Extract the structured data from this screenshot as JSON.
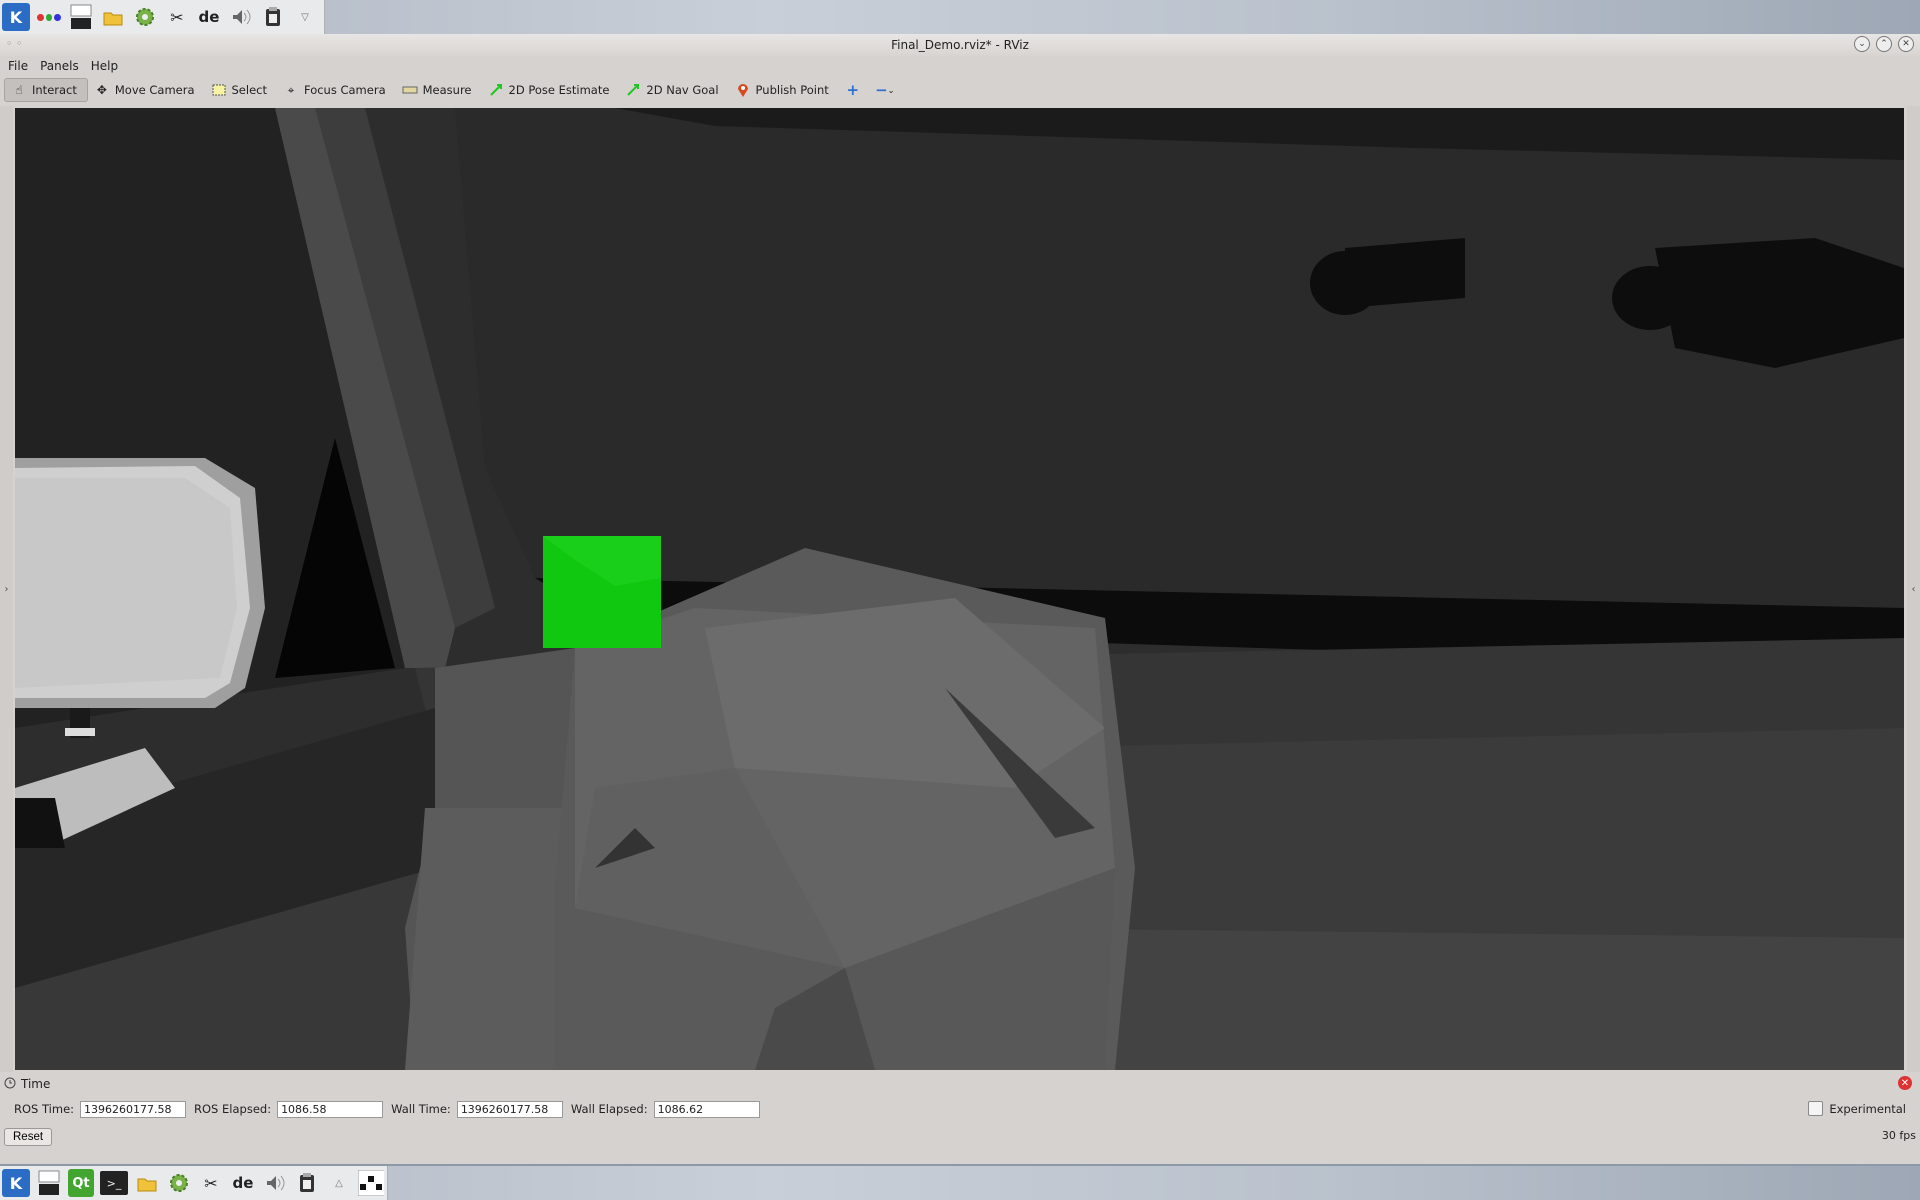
{
  "taskbar_top": {
    "layout_indicator": "de"
  },
  "window": {
    "title": "Final_Demo.rviz* - RViz"
  },
  "menubar": {
    "items": [
      "File",
      "Panels",
      "Help"
    ]
  },
  "toolbar": {
    "tools": [
      {
        "label": "Interact",
        "icon": "hand-icon",
        "active": true
      },
      {
        "label": "Move Camera",
        "icon": "move-camera-icon",
        "active": false
      },
      {
        "label": "Select",
        "icon": "select-icon",
        "active": false
      },
      {
        "label": "Focus Camera",
        "icon": "focus-camera-icon",
        "active": false
      },
      {
        "label": "Measure",
        "icon": "measure-icon",
        "active": false
      },
      {
        "label": "2D Pose Estimate",
        "icon": "pose-arrow-icon",
        "active": false
      },
      {
        "label": "2D Nav Goal",
        "icon": "nav-arrow-icon",
        "active": false
      },
      {
        "label": "Publish Point",
        "icon": "map-pin-icon",
        "active": false
      }
    ],
    "accent_colors": {
      "pose": "#22c622",
      "nav": "#22c622",
      "pin": "#d9481c",
      "add": "#2e6fd1"
    }
  },
  "viewport": {
    "marker_color": "#10c810"
  },
  "time_panel": {
    "title": "Time",
    "ros_time_label": "ROS Time:",
    "ros_time_value": "1396260177.58",
    "ros_elapsed_label": "ROS Elapsed:",
    "ros_elapsed_value": "1086.58",
    "wall_time_label": "Wall Time:",
    "wall_time_value": "1396260177.58",
    "wall_elapsed_label": "Wall Elapsed:",
    "wall_elapsed_value": "1086.62",
    "experimental_label": "Experimental",
    "reset_label": "Reset",
    "fps": "30 fps"
  },
  "taskbar_bottom": {
    "layout_indicator": "de",
    "qt_label": "Qt"
  }
}
